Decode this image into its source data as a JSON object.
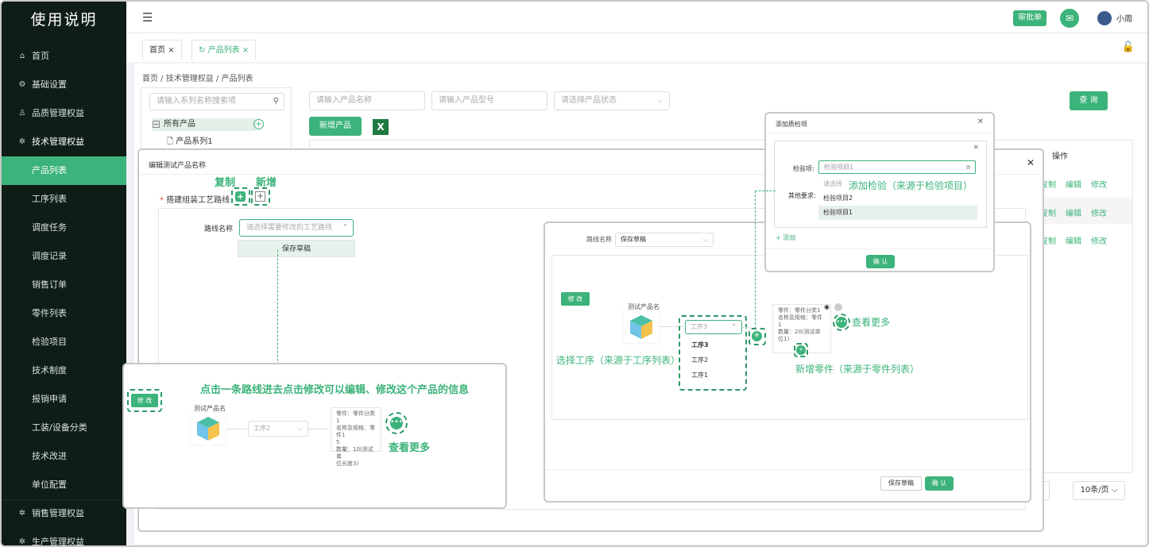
{
  "sidebar": {
    "title": "使用说明",
    "items": [
      {
        "label": "首页",
        "icon": "home-icon"
      },
      {
        "label": "基础设置",
        "icon": "settings-icon"
      },
      {
        "label": "品质管理权益",
        "icon": "user-icon"
      },
      {
        "label": "技术管理权益",
        "icon": "tech-icon"
      },
      {
        "label": "产品列表"
      },
      {
        "label": "工序列表"
      },
      {
        "label": "调度任务"
      },
      {
        "label": "调度记录"
      },
      {
        "label": "销售订单"
      },
      {
        "label": "零件列表"
      },
      {
        "label": "检验项目"
      },
      {
        "label": "技术制度"
      },
      {
        "label": "报销申请"
      },
      {
        "label": "工装/设备分类"
      },
      {
        "label": "技术改进"
      },
      {
        "label": "单位配置"
      },
      {
        "label": "销售管理权益",
        "icon": "sales-icon"
      },
      {
        "label": "生产管理权益",
        "icon": "production-icon"
      }
    ]
  },
  "header": {
    "approve_label": "审批单",
    "user_name": "小周"
  },
  "tabs": [
    {
      "label": "首页"
    },
    {
      "label": "产品列表"
    }
  ],
  "breadcrumb": "首页 / 技术管理权益 / 产品列表",
  "tree": {
    "search_placeholder": "请输入系列名称搜索项",
    "root": "所有产品",
    "child": "产品系列1"
  },
  "filters": {
    "name_placeholder": "请输入产品名称",
    "model_placeholder": "请输入产品型号",
    "status_placeholder": "请选择产品状态",
    "query_label": "查 询",
    "add_label": "新增产品"
  },
  "table": {
    "op_header": "操作",
    "row_ops": [
      "复制",
      "编辑",
      "修改"
    ]
  },
  "pager": {
    "page_size": "10条/页"
  },
  "modal_edit": {
    "title": "编辑测试产品名称",
    "copy_label": "复制",
    "new_label": "新增",
    "route_field_label": "搭建组装工艺路线",
    "route_name_label": "路线名称",
    "route_name_placeholder": "请选择需要修改的工艺路线",
    "save_draft": "保存草稿"
  },
  "callout_edit": {
    "instruction": "点击一条路线进去点击修改可以编辑、修改这个产品的信息",
    "modify_label": "修 改",
    "product_name": "测试产品名",
    "process_value": "工序2",
    "info_lines": [
      "零件：零件分类1",
      "名称及规格：零件1",
      "5",
      "数量：10(测试单",
      "位长度3)"
    ],
    "see_more": "查看更多"
  },
  "callout_route": {
    "route_name_label": "路线名称",
    "route_name_value": "保存草稿",
    "modify_label": "修 改",
    "product_name": "测试产品名",
    "process_value": "工序3",
    "process_options": [
      "工序3",
      "工序2",
      "工序1"
    ],
    "select_process_hint": "选择工序（来源于工序列表）",
    "info_lines": [
      "零件：零件分类1",
      "名称及规格：零件",
      "1",
      "数量：20(测试单",
      "位1)"
    ],
    "see_more": "查看更多",
    "new_part_hint": "新增零件（来源于零件列表）",
    "save_draft": "保存草稿",
    "confirm": "确 认"
  },
  "callout_inspect": {
    "title": "添加质检项",
    "item_label": "检验项:",
    "item_value": "检验项目1",
    "other_label": "其他要求:",
    "dropdown_placeholder": "请选择",
    "options": [
      "检验项目2",
      "检验项目1"
    ],
    "add_hint": "添加检验（来源于检验项目）",
    "add_link": "+ 添加",
    "confirm": "确 认"
  },
  "colors": {
    "accent": "#3cb37a",
    "sidebar_bg": "#0f1d17"
  }
}
